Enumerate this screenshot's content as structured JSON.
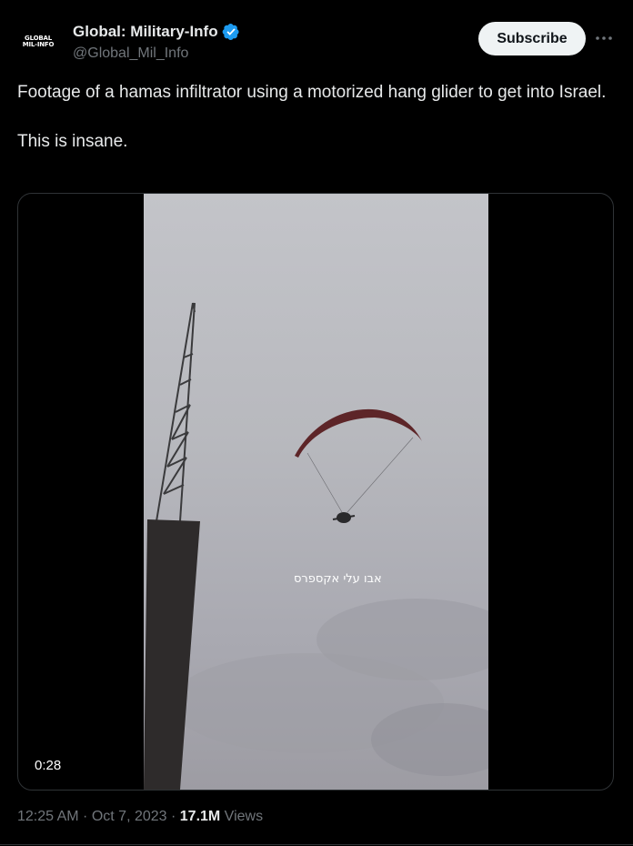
{
  "author": {
    "avatar_line1": "GLOBAL",
    "avatar_line2": "MIL-INFO",
    "display_name": "Global: Military-Info",
    "handle": "@Global_Mil_Info",
    "verified_icon": "verified-badge-icon"
  },
  "actions": {
    "subscribe_label": "Subscribe",
    "more_icon": "more-icon"
  },
  "tweet": {
    "text_line1": "Footage of a hamas infiltrator using a motorized hang glider to get into Israel.",
    "text_line2": "This is insane."
  },
  "video": {
    "overlay_caption": "אבו עלי אקספרס",
    "duration": "0:28"
  },
  "meta": {
    "time": "12:25 AM",
    "separator1": " · ",
    "date": "Oct 7, 2023",
    "separator2": " · ",
    "views_count": "17.1M",
    "views_label": " Views"
  },
  "colors": {
    "background": "#000000",
    "text_primary": "#e7e9ea",
    "text_secondary": "#71767b",
    "verified_blue": "#1d9bf0",
    "button_bg": "#eff3f4",
    "border": "#2f3336"
  }
}
